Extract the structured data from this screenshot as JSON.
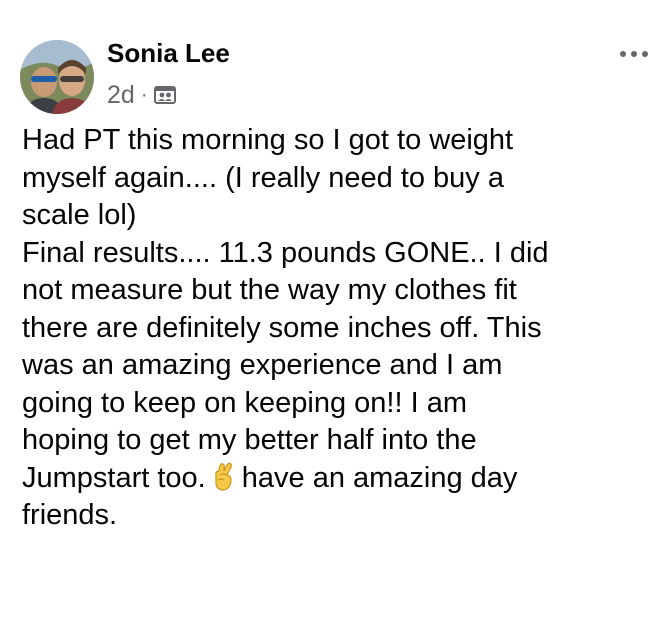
{
  "post": {
    "author": "Sonia Lee",
    "time": "2d",
    "separator": "·",
    "audience_icon": "friends-audience-icon",
    "more_icon": "more-options-icon",
    "text_lines": [
      "Had PT this morning so I got to weight",
      "myself again.... (I really need to buy a",
      "scale lol)",
      "Final results.... 11.3 pounds GONE..  I did",
      "not measure but the way my clothes fit",
      "there are definitely some inches off. This",
      "was an amazing experience and I am",
      "going to keep on keeping on!! I am",
      "hoping to get my better half into the"
    ],
    "last_line_before_emoji": "Jumpstart too.",
    "emoji": "crossed-fingers-emoji",
    "last_line_after_emoji": "have an amazing day",
    "final_line": "friends."
  }
}
